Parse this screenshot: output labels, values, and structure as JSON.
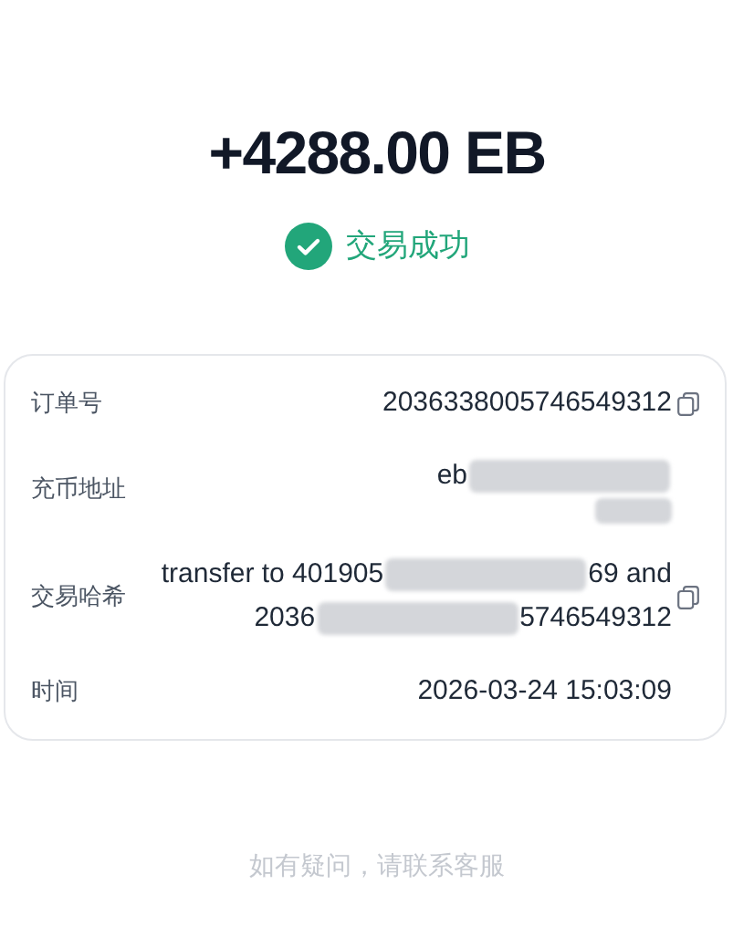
{
  "amount": "+4288.00 EB",
  "status": {
    "text": "交易成功",
    "success": true
  },
  "details": [
    {
      "label": "订单号",
      "copyable": true,
      "lines": [
        [
          {
            "kind": "text",
            "text": "2036338005746549312"
          }
        ]
      ]
    },
    {
      "label": "充币地址",
      "copyable": false,
      "lines": [
        [
          {
            "kind": "text",
            "text": "eb"
          },
          {
            "kind": "redacted"
          }
        ],
        [
          {
            "kind": "redacted_short"
          }
        ]
      ]
    },
    {
      "label": "交易哈希",
      "copyable": true,
      "lines": [
        [
          {
            "kind": "text",
            "text": "transfer to 401905"
          },
          {
            "kind": "redacted"
          },
          {
            "kind": "text",
            "text": "69 and"
          }
        ],
        [
          {
            "kind": "text",
            "text": "2036"
          },
          {
            "kind": "redacted"
          },
          {
            "kind": "text",
            "text": "5746549312"
          }
        ]
      ]
    },
    {
      "label": "时间",
      "copyable": false,
      "lines": [
        [
          {
            "kind": "text",
            "text": "2026-03-24 15:03:09"
          }
        ]
      ]
    }
  ],
  "footer": "如有疑问，请联系客服"
}
